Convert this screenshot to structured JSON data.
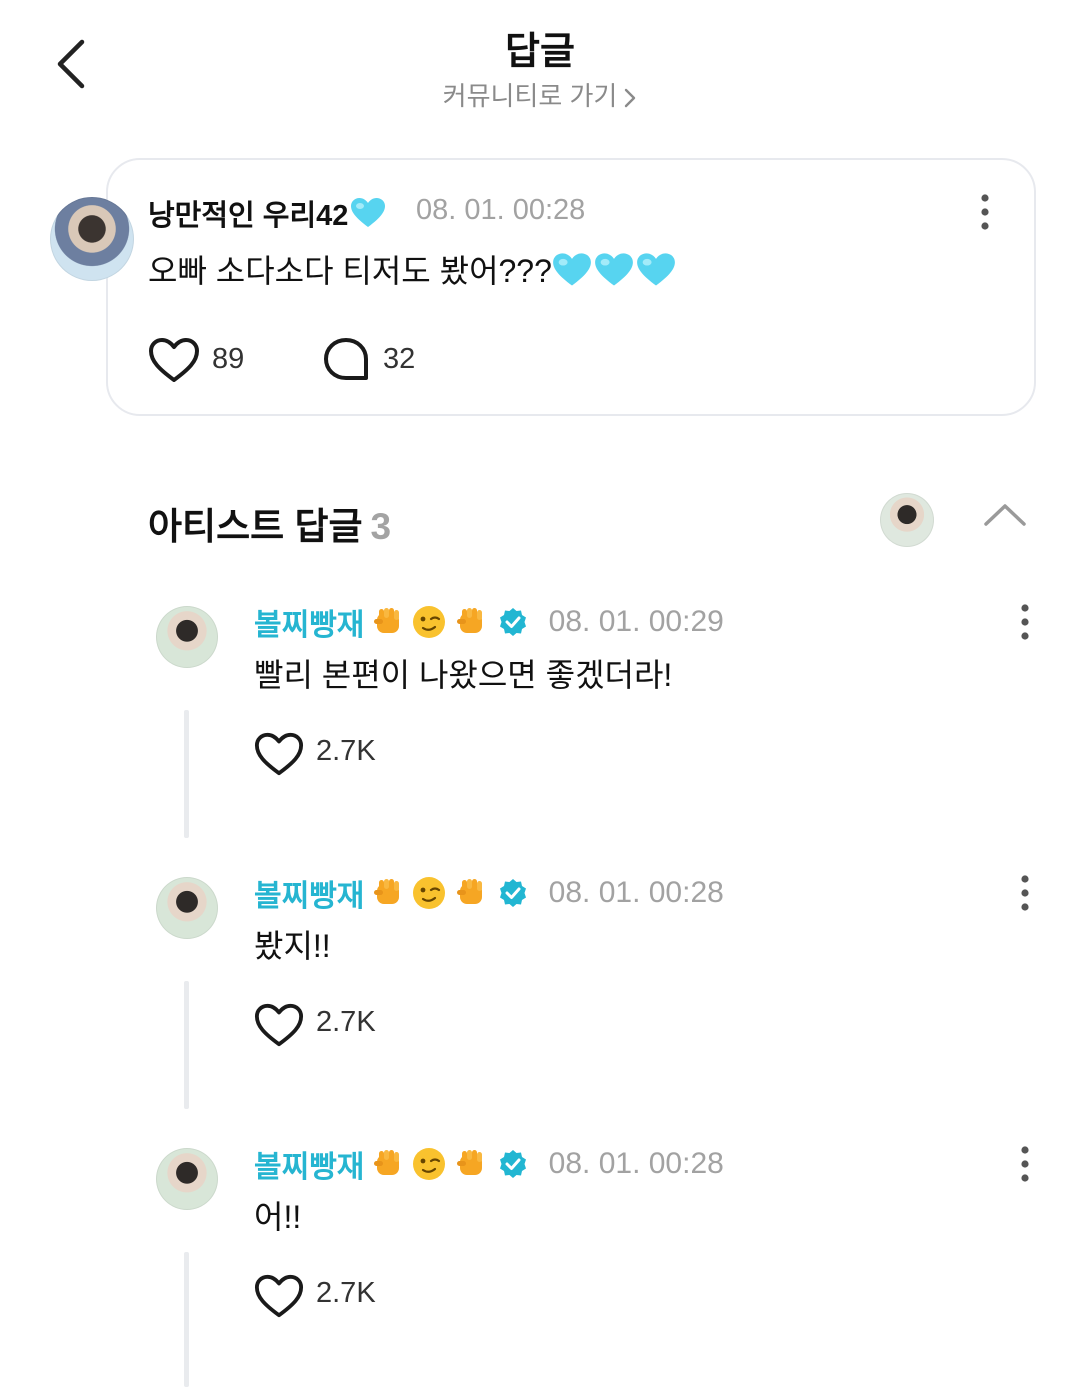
{
  "header": {
    "title": "답글",
    "community_link": "커뮤니티로 가기"
  },
  "post": {
    "author": "낭만적인 우리42",
    "author_emoji": "light-blue-heart",
    "time": "08. 01. 00:28",
    "text": "오빠 소다소다 티저도 봤어???",
    "text_emoji": [
      "light-blue-heart",
      "light-blue-heart",
      "light-blue-heart"
    ],
    "likes": "89",
    "comments": "32"
  },
  "artist_section": {
    "title": "아티스트 답글",
    "count": "3"
  },
  "replies": [
    {
      "author": "볼찌빵재",
      "time": "08. 01. 00:29",
      "text": "빨리 본편이 나왔으면 좋겠더라!",
      "likes": "2.7K"
    },
    {
      "author": "볼찌빵재",
      "time": "08. 01. 00:28",
      "text": "봤지!!",
      "likes": "2.7K"
    },
    {
      "author": "볼찌빵재",
      "time": "08. 01. 00:28",
      "text": "어!!",
      "likes": "2.7K"
    }
  ],
  "reply_author_emoji": [
    "raised-fist",
    "winking-face",
    "raised-fist"
  ],
  "colors": {
    "artist_name": "#26b5d1",
    "verified_badge": "#22b6d2",
    "heart_emoji": "#57d4f0",
    "muted_text": "#a2a2a2",
    "card_border": "#e7e9ee"
  }
}
